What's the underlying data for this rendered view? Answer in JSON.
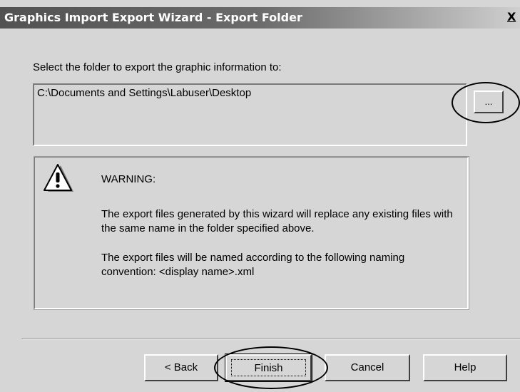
{
  "window": {
    "title": "Graphics Import Export Wizard - Export Folder",
    "close_label": "X"
  },
  "form": {
    "prompt": "Select the folder to export the graphic information to:",
    "folder_path": "C:\\Documents and Settings\\Labuser\\Desktop",
    "browse_label": "..."
  },
  "warning": {
    "icon": "warning-icon",
    "heading": "WARNING:",
    "text_1": "The export files generated by this wizard will replace any existing files with the same name in the folder specified above.",
    "text_2": "The export files will be named according to the following naming convention:  <display name>.xml"
  },
  "buttons": {
    "back": "< Back",
    "finish": "Finish",
    "cancel": "Cancel",
    "help": "Help"
  }
}
